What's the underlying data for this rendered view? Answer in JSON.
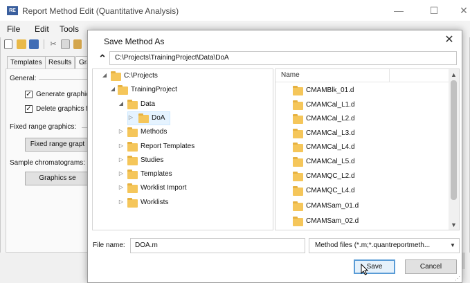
{
  "background_window": {
    "title": "Report Method Edit (Quantitative Analysis)",
    "app_icon_text": "RE",
    "window_controls": [
      "—",
      "☐",
      "✕"
    ],
    "menu": [
      "File",
      "Edit",
      "Tools"
    ],
    "tabs": [
      "Templates",
      "Results",
      "Gra"
    ],
    "general_label": "General:",
    "checkbox_generate": "Generate graphic",
    "checkbox_delete": "Delete graphics fi",
    "fixed_range_label": "Fixed range graphics:",
    "fixed_range_button": "Fixed range grapt",
    "sample_chrom_label": "Sample chromatograms:",
    "graphics_button": "Graphics se"
  },
  "dialog": {
    "title": "Save Method As",
    "close_glyph": "✕",
    "up_glyph": "⌃",
    "path": "C:\\Projects\\TrainingProject\\Data\\DoA",
    "tree": [
      {
        "label": "C:\\Projects",
        "expander": "◢"
      },
      {
        "label": "TrainingProject",
        "expander": "◢"
      },
      {
        "label": "Data",
        "expander": "◢"
      },
      {
        "label": "DoA",
        "expander": "▷"
      },
      {
        "label": "Methods",
        "expander": "▷"
      },
      {
        "label": "Report Templates",
        "expander": "▷"
      },
      {
        "label": "Studies",
        "expander": "▷"
      },
      {
        "label": "Templates",
        "expander": "▷"
      },
      {
        "label": "Worklist Import",
        "expander": "▷"
      },
      {
        "label": "Worklists",
        "expander": "▷"
      }
    ],
    "list_header": "Name",
    "files": [
      "CMAMBlk_01.d",
      "CMAMCal_L1.d",
      "CMAMCal_L2.d",
      "CMAMCal_L3.d",
      "CMAMCal_L4.d",
      "CMAMCal_L5.d",
      "CMAMQC_L2.d",
      "CMAMQC_L4.d",
      "CMAMSam_01.d",
      "CMAMSam_02.d"
    ],
    "file_name_label": "File name:",
    "file_name_value": "DOA.m",
    "filter_value": "Method files (*.m;*.quantreportmeth...",
    "save_label": "Save",
    "cancel_label": "Cancel"
  },
  "colors": {
    "folder": "#f5c65a",
    "selection": "#e5f3ff",
    "save_border": "#5a9cd6"
  }
}
